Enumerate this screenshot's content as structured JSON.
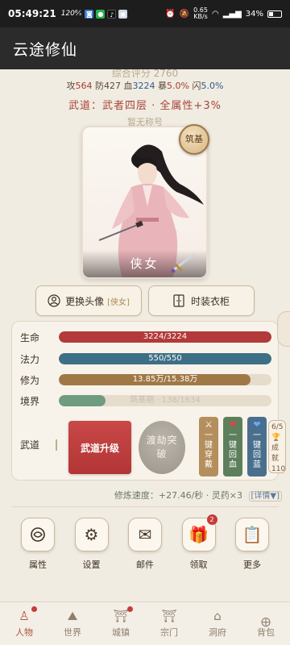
{
  "statusbar": {
    "time": "05:49:21",
    "net_speed": "120⁶⁄ₛ",
    "right_speed": "0.65",
    "right_speed_unit": "KB/s",
    "battery": "34%"
  },
  "appbar": {
    "title": "云途修仙"
  },
  "stats": {
    "score_label": "综合评分 2760",
    "atk_label": "攻",
    "atk": "564",
    "def_label": "防",
    "def": "427",
    "hp_label": "血",
    "hp": "3224",
    "crit_label": "暴",
    "crit": "5.0%",
    "dodge_label": "闪",
    "dodge": "5.0%",
    "wudao": "武道：武者四层 · 全属性+3%",
    "title": "暂无称号"
  },
  "portrait": {
    "name": "侠女",
    "realm_badge": "筑基"
  },
  "buttons": {
    "change_avatar": "更换头像",
    "avatar_tag": "[侠女]",
    "wardrobe": "时装衣柜"
  },
  "bars": {
    "life_label": "生命",
    "life_text": "3224/3224",
    "life_ratio": 1.0,
    "mana_label": "法力",
    "mana_text": "550/550",
    "mana_ratio": 1.0,
    "cult_label": "修为",
    "cult_text": "13.85万/15.38万",
    "cult_ratio": 0.9,
    "realm_label": "境界",
    "realm_text": "筑基期 · 138/1634",
    "realm_ratio": 0.22
  },
  "wudao_section": {
    "label": "武道",
    "upgrade": "武道升级",
    "tribulation": "渡劫突破",
    "dress": "一键穿戴",
    "heal": "一键回血",
    "mana": "一键回蓝",
    "cut_1": "6/5",
    "cut_2": "成就",
    "cut_3": "110"
  },
  "speed": {
    "text": "修炼速度：+27.46/秒 · 灵药×3",
    "detail": "[详情▼]"
  },
  "quick": [
    {
      "label": "属性",
      "icon": "attribute-icon"
    },
    {
      "label": "设置",
      "icon": "gear-icon"
    },
    {
      "label": "邮件",
      "icon": "mail-icon"
    },
    {
      "label": "领取",
      "icon": "gift-icon",
      "badge": "2"
    },
    {
      "label": "更多",
      "icon": "more-icon"
    }
  ],
  "nav": [
    {
      "label": "人物",
      "active": true
    },
    {
      "label": "世界"
    },
    {
      "label": "城镇"
    },
    {
      "label": "宗门"
    },
    {
      "label": "洞府"
    },
    {
      "label": "背包"
    }
  ],
  "colors": {
    "life": "#b23a3a",
    "mana": "#3d6f86",
    "cult": "#a07846",
    "realm": "#6f9c7f",
    "accent": "#b0533d"
  }
}
